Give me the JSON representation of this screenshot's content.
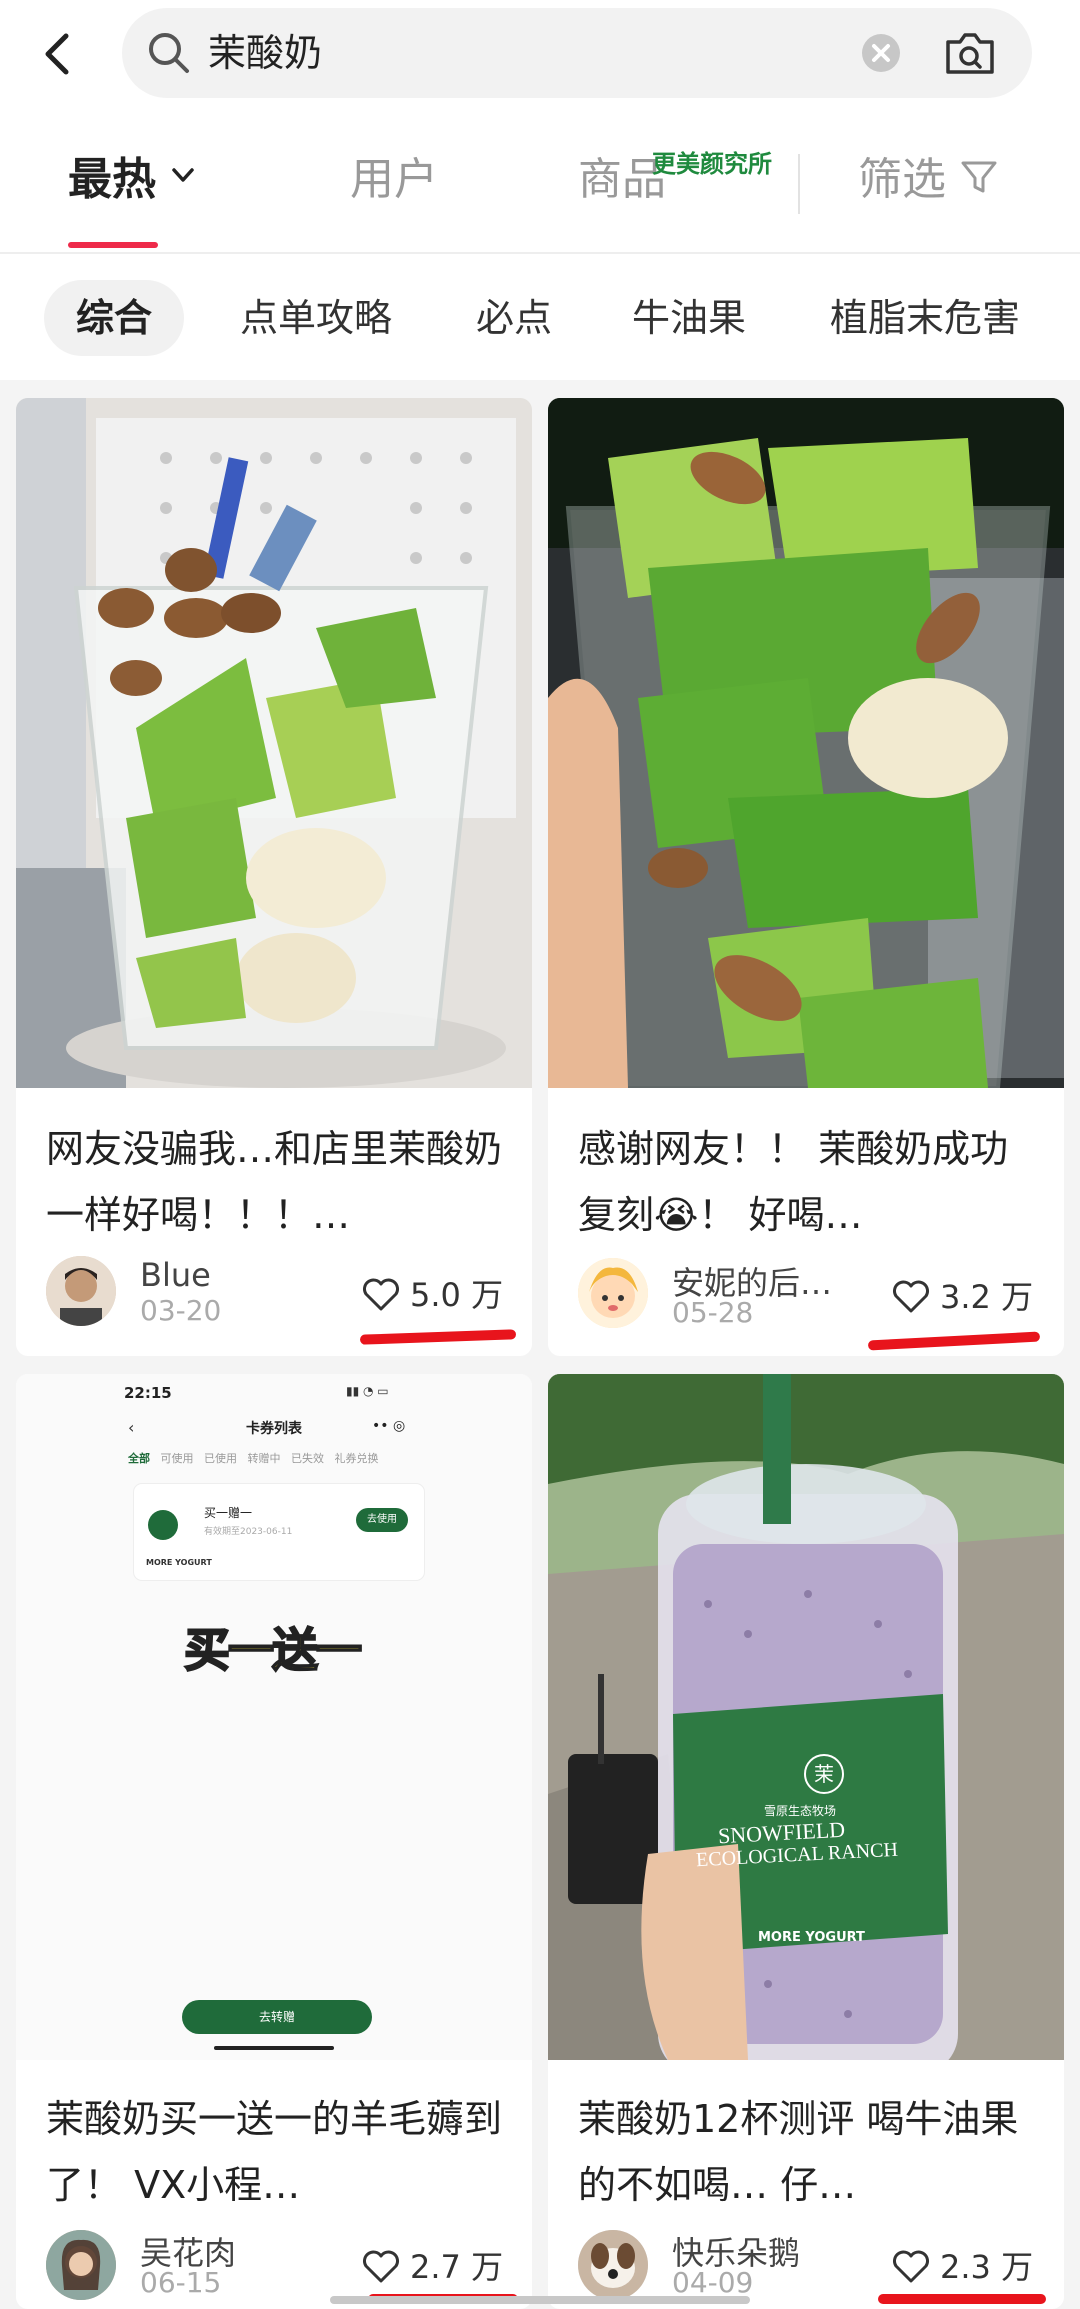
{
  "search": {
    "query": "茉酸奶"
  },
  "tabs": {
    "hot": "最热",
    "users": "用户",
    "goods": "商品",
    "filter": "筛选"
  },
  "watermark": "更美颜究所",
  "chips": [
    "综合",
    "点单攻略",
    "必点",
    "牛油果",
    "植脂末危害"
  ],
  "cards": [
    {
      "title": "网友没骗我…和店里茉酸奶一样好喝！！！…",
      "author": "Blue",
      "date": "03-20",
      "likes": "5.0 万"
    },
    {
      "title": "感谢网友！！ 茉酸奶成功复刻😭！ 好喝…",
      "author": "安妮的后…",
      "date": "05-28",
      "likes": "3.2 万"
    },
    {
      "title": "茉酸奶买一送一的羊毛薅到了！ VX小程…",
      "author": "吴花肉",
      "date": "06-15",
      "likes": "2.7 万",
      "phone": {
        "time": "22:15",
        "page_title": "卡券列表",
        "tabs": [
          "全部",
          "可使用",
          "已使用",
          "转赠中",
          "已失效",
          "礼券兑换"
        ],
        "coupon_name": "买一赠一",
        "coupon_expiry": "有效期至2023-06-11",
        "use_btn": "去使用",
        "brand": "MORE YOGURT",
        "overlay": "买一送一",
        "bottom_btn": "去转赠"
      }
    },
    {
      "title": "茉酸奶12杯测评 喝牛油果的不如喝… 仔…",
      "author": "快乐朵鹅",
      "date": "04-09",
      "likes": "2.3 万",
      "cup": {
        "logo": "茉",
        "line1": "雪原生态牧场",
        "line2": "SNOWFIELD",
        "line3": "ECOLOGICAL RANCH",
        "line4": "MORE YOGURT"
      }
    }
  ]
}
